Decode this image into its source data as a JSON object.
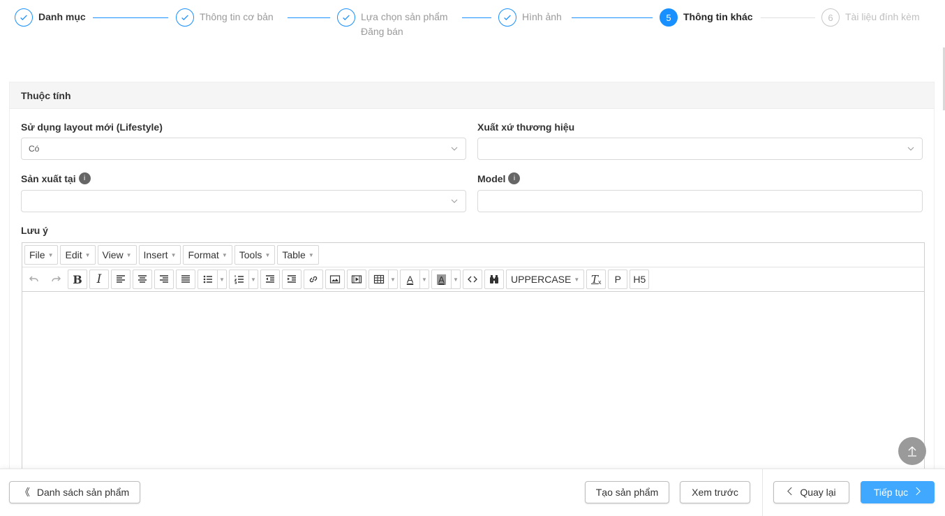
{
  "stepper": {
    "steps": [
      {
        "label": "Danh mục",
        "state": "first"
      },
      {
        "label": "Thông tin cơ bản",
        "state": "done"
      },
      {
        "label": "Lựa chọn sản phẩm",
        "label2": "Đăng bán",
        "state": "done"
      },
      {
        "label": "Hình ảnh",
        "state": "done"
      },
      {
        "number": "5",
        "label": "Thông tin khác",
        "state": "active"
      },
      {
        "number": "6",
        "label": "Tài liệu đính kèm",
        "state": "wait"
      }
    ]
  },
  "card": {
    "title": "Thuộc tính",
    "fields": {
      "layout_label": "Sử dụng layout mới (Lifestyle)",
      "layout_value": "Có",
      "origin_label": "Xuất xứ thương hiệu",
      "origin_value": "",
      "made_in_label": "Sản xuất tại",
      "made_in_value": "",
      "model_label": "Model",
      "model_value": "",
      "note_label": "Lưu ý",
      "info_badge": "i"
    }
  },
  "editor": {
    "menus": [
      "File",
      "Edit",
      "View",
      "Insert",
      "Format",
      "Tools",
      "Table"
    ],
    "uppercase_label": "UPPERCASE",
    "p_label": "P",
    "h5_label": "H5",
    "bold_label": "B",
    "italic_label": "I",
    "forecolor_label": "A",
    "backcolor_label": "A",
    "clear_format_label": "T",
    "content": ""
  },
  "footer": {
    "product_list": "Danh sách sản phẩm",
    "create_product": "Tạo sản phẩm",
    "preview": "Xem trước",
    "back": "Quay lại",
    "next": "Tiếp tục"
  },
  "colors": {
    "accent": "#1890ff",
    "primary_button": "#40a9ff"
  }
}
